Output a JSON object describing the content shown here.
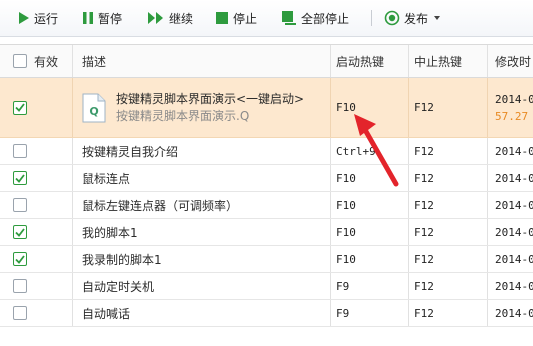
{
  "toolbar": {
    "run_label": "运行",
    "pause_label": "暂停",
    "continue_label": "继续",
    "stop_label": "停止",
    "stop_all_label": "全部停止",
    "publish_label": "发布"
  },
  "table": {
    "headers": {
      "enabled": "有效",
      "description": "描述",
      "start_hotkey": "启动热键",
      "stop_hotkey": "中止热键",
      "modified": "修改时"
    },
    "rows": [
      {
        "checked": true,
        "desc": "按键精灵脚本界面演示<一键启动>",
        "desc_sub": "按键精灵脚本界面演示.Q",
        "start": "F10",
        "stop": "F12",
        "modified": "2014-0",
        "modified_sub": "57.27",
        "selected": true
      },
      {
        "checked": false,
        "desc": "按键精灵自我介绍",
        "start": "Ctrl+9",
        "stop": "F12",
        "modified": "2014-0"
      },
      {
        "checked": true,
        "desc": "鼠标连点",
        "start": "F10",
        "stop": "F12",
        "modified": "2014-0"
      },
      {
        "checked": false,
        "desc": "鼠标左键连点器（可调频率）",
        "start": "F10",
        "stop": "F12",
        "modified": "2014-0"
      },
      {
        "checked": true,
        "desc": "我的脚本1",
        "start": "F10",
        "stop": "F12",
        "modified": "2014-0"
      },
      {
        "checked": true,
        "desc": "我录制的脚本1",
        "start": "F10",
        "stop": "F12",
        "modified": "2014-0"
      },
      {
        "checked": false,
        "desc": "自动定时关机",
        "start": "F9",
        "stop": "F12",
        "modified": "2014-0"
      },
      {
        "checked": false,
        "desc": "自动喊话",
        "start": "F9",
        "stop": "F12",
        "modified": "2014-0"
      }
    ]
  },
  "colors": {
    "accent_green": "#2e9b3e",
    "selected_row": "#fde8cf",
    "arrow_red": "#e3242b"
  },
  "icons": [
    "play-icon",
    "pause-icon",
    "continue-icon",
    "stop-icon",
    "stop-all-icon",
    "publish-icon",
    "file-q-icon",
    "checkbox-check-icon",
    "annotation-arrow"
  ]
}
